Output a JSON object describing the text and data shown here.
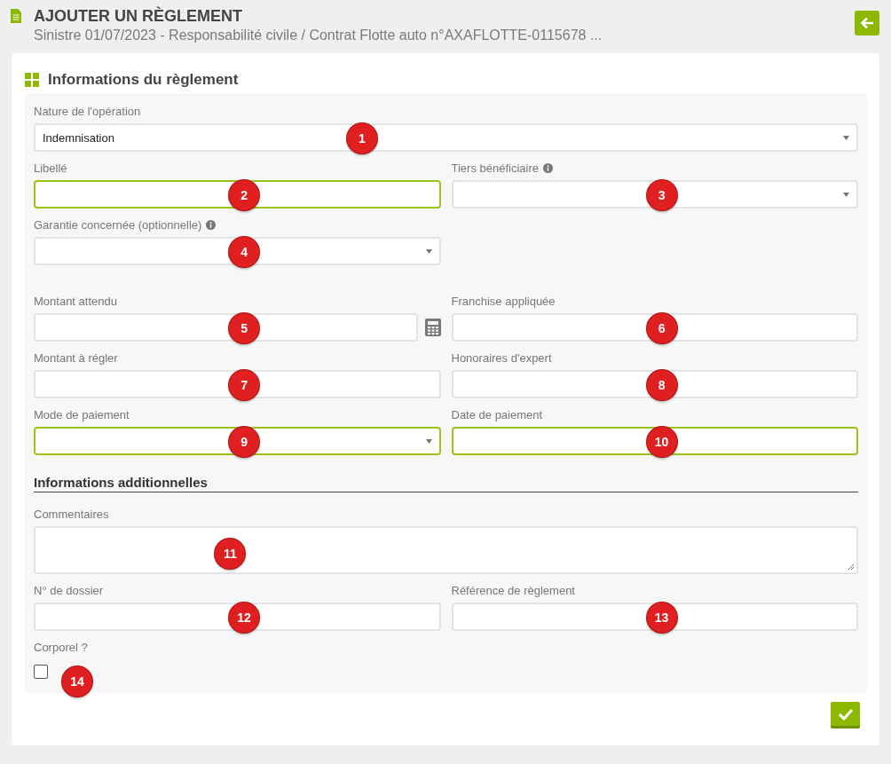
{
  "header": {
    "title": "AJOUTER UN RÈGLEMENT",
    "subtitle": "Sinistre 01/07/2023 - Responsabilité civile / Contrat Flotte auto n°AXAFLOTTE-0115678 ..."
  },
  "panel": {
    "title": "Informations du règlement"
  },
  "sections": [
    {
      "rows": [
        [
          {
            "kind": "select",
            "label": "Nature de l'opération",
            "value": "Indemnisation",
            "highlighted": false,
            "badge": "1"
          }
        ],
        [
          {
            "kind": "text",
            "label": "Libellé",
            "highlighted": true,
            "badge": "2"
          },
          {
            "kind": "select",
            "label": "Tiers bénéficiaire",
            "highlighted": false,
            "info": true,
            "badge": "3"
          }
        ],
        [
          {
            "kind": "select",
            "label": "Garantie concernée (optionnelle)",
            "highlighted": false,
            "info": true,
            "badge": "4"
          }
        ]
      ]
    },
    {
      "rows": [
        [
          {
            "kind": "text",
            "label": "Montant attendu",
            "highlighted": false,
            "calculator": true,
            "badge": "5"
          },
          {
            "kind": "text",
            "label": "Franchise appliquée",
            "highlighted": false,
            "badge": "6"
          }
        ],
        [
          {
            "kind": "text",
            "label": "Montant à régler",
            "highlighted": false,
            "badge": "7"
          },
          {
            "kind": "text",
            "label": "Honoraires d'expert",
            "highlighted": false,
            "badge": "8"
          }
        ],
        [
          {
            "kind": "select",
            "label": "Mode de paiement",
            "highlighted": true,
            "badge": "9"
          },
          {
            "kind": "text",
            "label": "Date de paiement",
            "highlighted": true,
            "badge": "10"
          }
        ]
      ]
    },
    {
      "heading": "Informations additionnelles",
      "rows": [
        [
          {
            "kind": "textarea",
            "label": "Commentaires",
            "highlighted": false,
            "badge": "11"
          }
        ],
        [
          {
            "kind": "text",
            "label": "N° de dossier",
            "highlighted": false,
            "badge": "12"
          },
          {
            "kind": "text",
            "label": "Référence de règlement",
            "highlighted": false,
            "badge": "13"
          }
        ],
        [
          {
            "kind": "checkbox",
            "label": "Corporel ?",
            "checked": false,
            "badge": "14"
          }
        ]
      ]
    }
  ]
}
